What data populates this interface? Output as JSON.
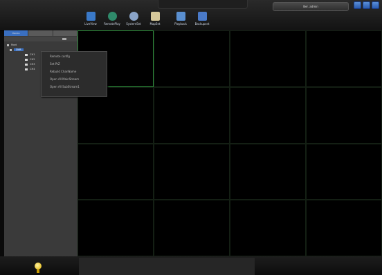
{
  "window": {
    "title": "",
    "user": "Ber. admin"
  },
  "toolbar": [
    {
      "label": "LiveView",
      "icon": "monitor-icon",
      "color": "#3a79c8"
    },
    {
      "label": "RemotePlay",
      "icon": "play-icon",
      "color": "#2f8a6a"
    },
    {
      "label": "SystemSet",
      "icon": "gear-icon",
      "color": "#8aa4c8"
    },
    {
      "label": "MapSet",
      "icon": "map-icon",
      "color": "#d6c89a"
    },
    {
      "label": "Playback",
      "icon": "playback-icon",
      "color": "#5a8fd0"
    },
    {
      "label": "Backupset",
      "icon": "backup-icon",
      "color": "#4a7ac8"
    }
  ],
  "leftpanel": {
    "tabs": [
      "Device",
      "",
      ""
    ],
    "tree": [
      {
        "label": "Root",
        "level": 0
      },
      {
        "label": "DVR",
        "level": 1,
        "selected": true
      },
      {
        "label": "CH1",
        "level": 2
      },
      {
        "label": "CH2",
        "level": 2
      },
      {
        "label": "CH3",
        "level": 2
      },
      {
        "label": "CH4",
        "level": 2
      }
    ]
  },
  "context_menu": [
    "Remote config",
    "Set PtZ",
    "Rebuild ChanName",
    "Open All MainStream",
    "Open All SubStream1"
  ],
  "colors": {
    "accent": "#3a6fc0",
    "grid_active_border": "#2d8a3a",
    "background": "#000000"
  }
}
